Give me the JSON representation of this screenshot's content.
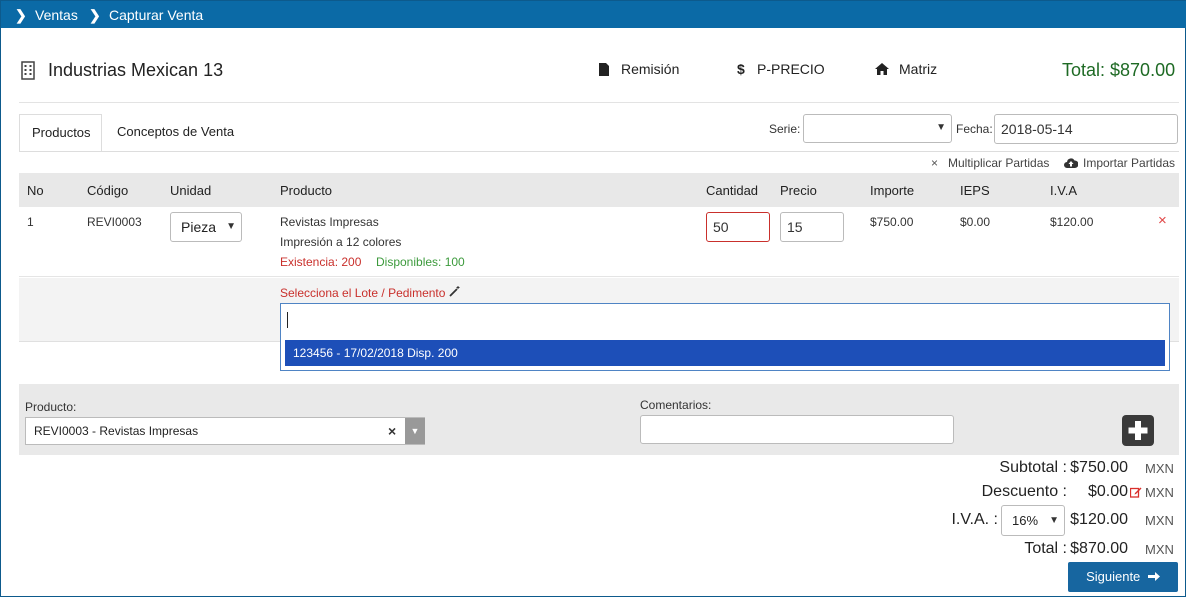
{
  "breadcrumb": {
    "item1": "Ventas",
    "item2": "Capturar Venta"
  },
  "header": {
    "company": "Industrias Mexican 13",
    "link_remision": "Remisión",
    "link_precio": "P-PRECIO",
    "link_matriz": "Matriz",
    "total": "Total: $870.00"
  },
  "tabs": {
    "productos": "Productos",
    "conceptos": "Conceptos de Venta"
  },
  "filters": {
    "serie_label": "Serie:",
    "fecha_label": "Fecha:",
    "fecha_value": "2018-05-14"
  },
  "actions": {
    "multiplicar": "Multiplicar Partidas",
    "importar": "Importar Partidas"
  },
  "table": {
    "headers": {
      "no": "No",
      "codigo": "Código",
      "unidad": "Unidad",
      "producto": "Producto",
      "cantidad": "Cantidad",
      "precio": "Precio",
      "importe": "Importe",
      "ieps": "IEPS",
      "iva": "I.V.A"
    },
    "row": {
      "no": "1",
      "codigo": "REVI0003",
      "unidad": "Pieza",
      "producto": "Revistas Impresas",
      "descripcion": "Impresión a 12 colores",
      "existencia": "Existencia: 200",
      "disponibles": "Disponibles: 100",
      "cantidad": "50",
      "precio": "15",
      "importe": "$750.00",
      "ieps": "$0.00",
      "iva": "$120.00"
    },
    "lote_label": "Selecciona el Lote / Pedimento",
    "lote_option": "123456 - 17/02/2018 Disp. 200"
  },
  "form": {
    "producto_label": "Producto:",
    "producto_value": "REVI0003 - Revistas Impresas",
    "comentarios_label": "Comentarios:"
  },
  "summary": {
    "subtotal_label": "Subtotal :",
    "subtotal_value": "$750.00",
    "descuento_label": "Descuento :",
    "descuento_value": "$0.00",
    "iva_label": "I.V.A. :",
    "iva_rate": "16%",
    "iva_value": "$120.00",
    "total_label": "Total :",
    "total_value": "$870.00",
    "currency": "MXN"
  },
  "buttons": {
    "siguiente": "Siguiente"
  },
  "colors": {
    "brand": "#0b6aa6",
    "total_green": "#1e6a24",
    "error_red": "#c9302c",
    "available_green": "#3c9a3c"
  }
}
